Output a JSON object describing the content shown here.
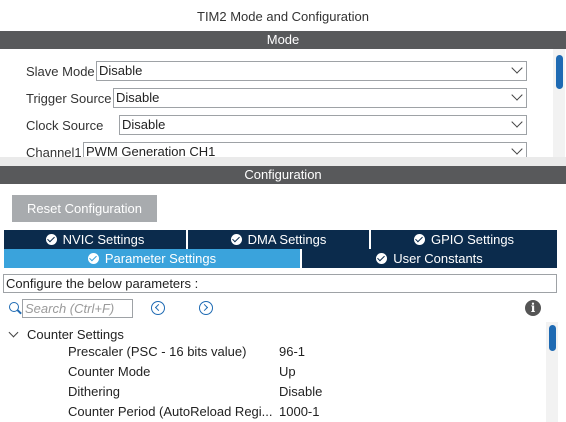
{
  "window": {
    "title": "TIM2 Mode and Configuration"
  },
  "mode_section": {
    "header": "Mode",
    "fields": [
      {
        "label": "Slave Mode",
        "value": "Disable"
      },
      {
        "label": "Trigger Source",
        "value": "Disable"
      },
      {
        "label": "Clock Source",
        "value": "Disable"
      },
      {
        "label": "Channel1",
        "value": "PWM Generation CH1"
      }
    ]
  },
  "config_section": {
    "header": "Configuration",
    "reset_label": "Reset Configuration",
    "tabs": [
      {
        "label": "NVIC Settings",
        "status": "check"
      },
      {
        "label": "DMA Settings",
        "status": "check"
      },
      {
        "label": "GPIO Settings",
        "status": "check"
      },
      {
        "label": "Parameter Settings",
        "status": "check",
        "active": true
      },
      {
        "label": "User Constants",
        "status": "check"
      }
    ],
    "configure_text": "Configure the below parameters :",
    "search": {
      "placeholder": "Search (Ctrl+F)"
    },
    "icons": {
      "search": "search-icon",
      "prev": "chevron-left-circle-icon",
      "next": "chevron-right-circle-icon",
      "info": "info-icon"
    },
    "parameters": {
      "group": "Counter Settings",
      "items": [
        {
          "name": "Prescaler (PSC - 16 bits value)",
          "value": "96-1"
        },
        {
          "name": "Counter Mode",
          "value": "Up"
        },
        {
          "name": "Dithering",
          "value": "Disable"
        },
        {
          "name": "Counter Period (AutoReload Regi...",
          "value": "1000-1"
        }
      ]
    }
  },
  "colors": {
    "band": "#58595b",
    "tab_dark": "#0b2b4c",
    "tab_active": "#3aa3dc",
    "accent": "#1e6ab3",
    "button_disabled": "#a8abae"
  }
}
